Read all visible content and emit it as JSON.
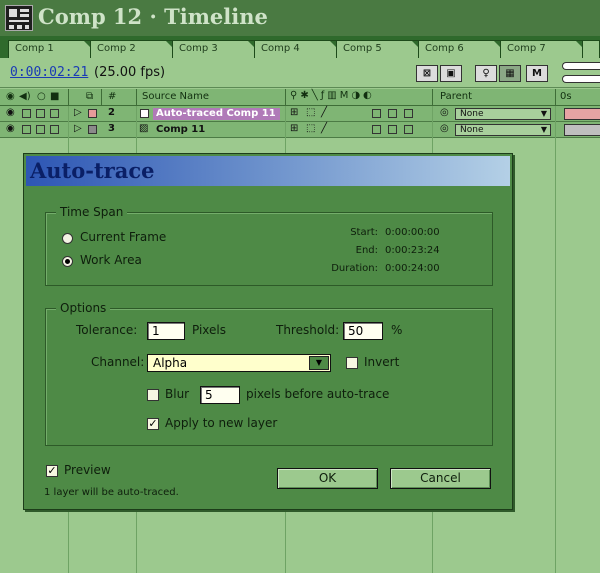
{
  "window": {
    "title": "Comp 12 · Timeline",
    "tabs": [
      "Comp 1",
      "Comp 2",
      "Comp 3",
      "Comp 4",
      "Comp 5",
      "Comp 6",
      "Comp 7",
      ""
    ]
  },
  "toolbar": {
    "timecode": "0:00:02:21",
    "fps": "(25.00 fps)",
    "mode_letter": "M"
  },
  "columns": {
    "number": "#",
    "source_name": "Source Name",
    "parent": "Parent",
    "time_start": "0s"
  },
  "layers": [
    {
      "number": "2",
      "name": "Auto-traced Comp 11",
      "label_color": "#e89a9a",
      "parent": "None",
      "bar_color": "#e6a4a4",
      "highlighted": true
    },
    {
      "number": "3",
      "name": "Comp 11",
      "label_color": "#8a8a8a",
      "parent": "None",
      "bar_color": "#bfbfbf",
      "highlighted": false
    }
  ],
  "dialog": {
    "title": "Auto-trace",
    "time_span": {
      "label": "Time Span",
      "options": [
        "Current Frame",
        "Work Area"
      ],
      "selected": "Work Area",
      "start_label": "Start:",
      "start": "0:00:00:00",
      "end_label": "End:",
      "end": "0:00:23:24",
      "duration_label": "Duration:",
      "duration": "0:00:24:00"
    },
    "options": {
      "label": "Options",
      "tolerance_label": "Tolerance:",
      "tolerance": "1",
      "pixels_label": "Pixels",
      "threshold_label": "Threshold:",
      "threshold": "50",
      "percent": "%",
      "channel_label": "Channel:",
      "channel": "Alpha",
      "invert_label": "Invert",
      "invert": false,
      "blur_label": "Blur",
      "blur_checked": false,
      "blur_value": "5",
      "blur_suffix": "pixels before auto-trace",
      "apply_label": "Apply to new layer",
      "apply_checked": true
    },
    "preview_label": "Preview",
    "preview_checked": true,
    "status": "1 layer will be auto-traced.",
    "ok": "OK",
    "cancel": "Cancel"
  },
  "colors": {
    "window_bg": "#9cc98e",
    "dialog_bg": "#4e8a46",
    "title_gradient_start": "#2d56b4",
    "highlight_name_bg": "#b07ab8",
    "timecode": "#1a3bb5"
  }
}
